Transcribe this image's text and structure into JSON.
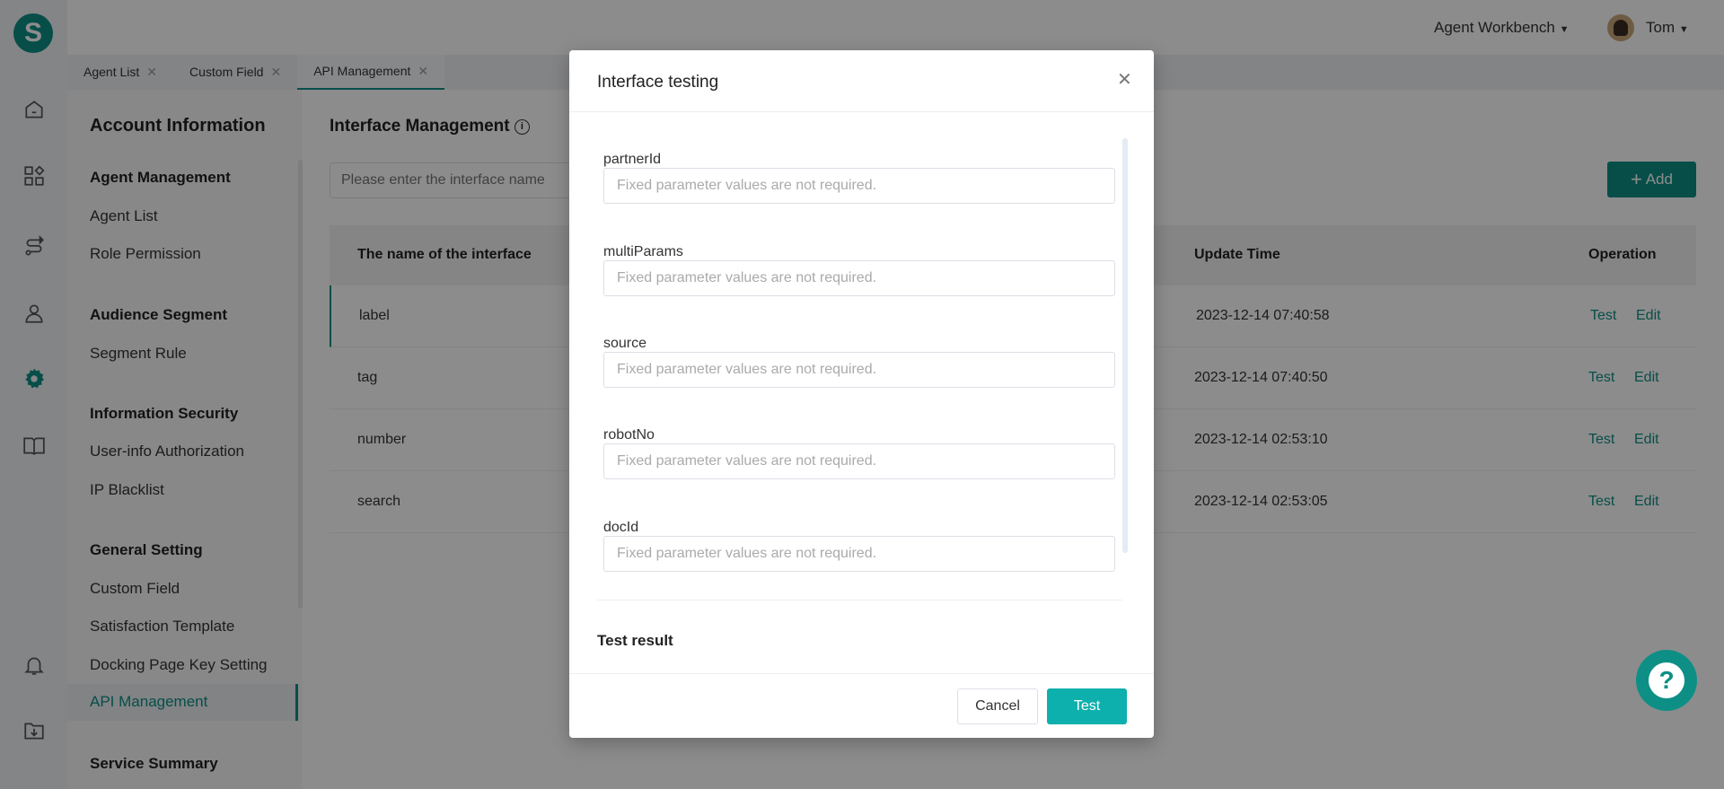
{
  "header": {
    "workbench": "Agent Workbench",
    "user": "Tom"
  },
  "tabs": [
    {
      "label": "Agent List"
    },
    {
      "label": "Custom Field"
    },
    {
      "label": "API Management"
    }
  ],
  "sidebar": {
    "title": "Account Information",
    "groups": [
      {
        "label": "Agent Management",
        "items": [
          "Agent List",
          "Role Permission"
        ]
      },
      {
        "label": "Audience Segment",
        "items": [
          "Segment Rule"
        ]
      },
      {
        "label": "Information Security",
        "items": [
          "User-info Authorization",
          "IP Blacklist"
        ]
      },
      {
        "label": "General Setting",
        "items": [
          "Custom Field",
          "Satisfaction Template",
          "Docking Page Key Setting",
          "API Management"
        ]
      },
      {
        "label": "Service Summary",
        "items": []
      }
    ],
    "active": "API Management"
  },
  "main": {
    "title": "Interface Management",
    "search_placeholder": "Please enter the interface name",
    "add_label": "Add",
    "columns": [
      "The name of the interface",
      "Update Time",
      "Operation"
    ],
    "rows": [
      {
        "name": "label",
        "time": "2023-12-14 07:40:58"
      },
      {
        "name": "tag",
        "time": "2023-12-14 07:40:50"
      },
      {
        "name": "number",
        "time": "2023-12-14 02:53:10"
      },
      {
        "name": "search",
        "time": "2023-12-14 02:53:05"
      }
    ],
    "test_label": "Test",
    "edit_label": "Edit"
  },
  "modal": {
    "title": "Interface testing",
    "fields": [
      {
        "label": "partnerId"
      },
      {
        "label": "multiParams"
      },
      {
        "label": "source"
      },
      {
        "label": "robotNo"
      },
      {
        "label": "docId"
      }
    ],
    "placeholder": "Fixed parameter values are not required.",
    "result_label": "Test result",
    "cancel": "Cancel",
    "test": "Test"
  },
  "colors": {
    "accent": "#0e8f86",
    "primary_button": "#0eb0ad"
  }
}
